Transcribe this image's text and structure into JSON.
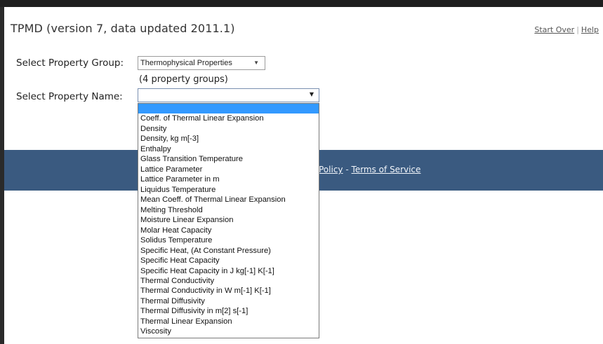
{
  "header": {
    "title": "TPMD (version 7, data updated 2011.1)",
    "links": {
      "start_over": "Start Over",
      "separator": "|",
      "help": "Help"
    }
  },
  "form": {
    "group_label": "Select Property Group:",
    "group_selected": "Thermophysical Properties",
    "group_count": "(4 property groups)",
    "name_label": "Select Property Name:",
    "name_selected": ""
  },
  "footer": {
    "links_text_1": "Policy",
    "links_separator": "-",
    "links_text_2": "Terms of Service"
  },
  "dropdown": {
    "options": [
      "",
      "Coeff. of Thermal Linear Expansion",
      "Density",
      "Density, kg m[-3]",
      "Enthalpy",
      "Glass Transition Temperature",
      "Lattice Parameter",
      "Lattice Parameter in m",
      "Liquidus Temperature",
      "Mean Coeff. of Thermal Linear Expansion",
      "Melting Threshold",
      "Moisture Linear Expansion",
      "Molar Heat Capacity",
      "Solidus Temperature",
      "Specific Heat, (At Constant Pressure)",
      "Specific Heat Capacity",
      "Specific Heat Capacity in J kg[-1] K[-1]",
      "Thermal Conductivity",
      "Thermal Conductivity in W m[-1] K[-1]",
      "Thermal Diffusivity",
      "Thermal Diffusivity in m[2] s[-1]",
      "Thermal Linear Expansion",
      "Viscosity"
    ]
  },
  "colors": {
    "footer_band": "#3a5a80",
    "selected_option": "#3399ff"
  },
  "icons": {
    "dropdown_caret": "chevron-down-icon"
  }
}
